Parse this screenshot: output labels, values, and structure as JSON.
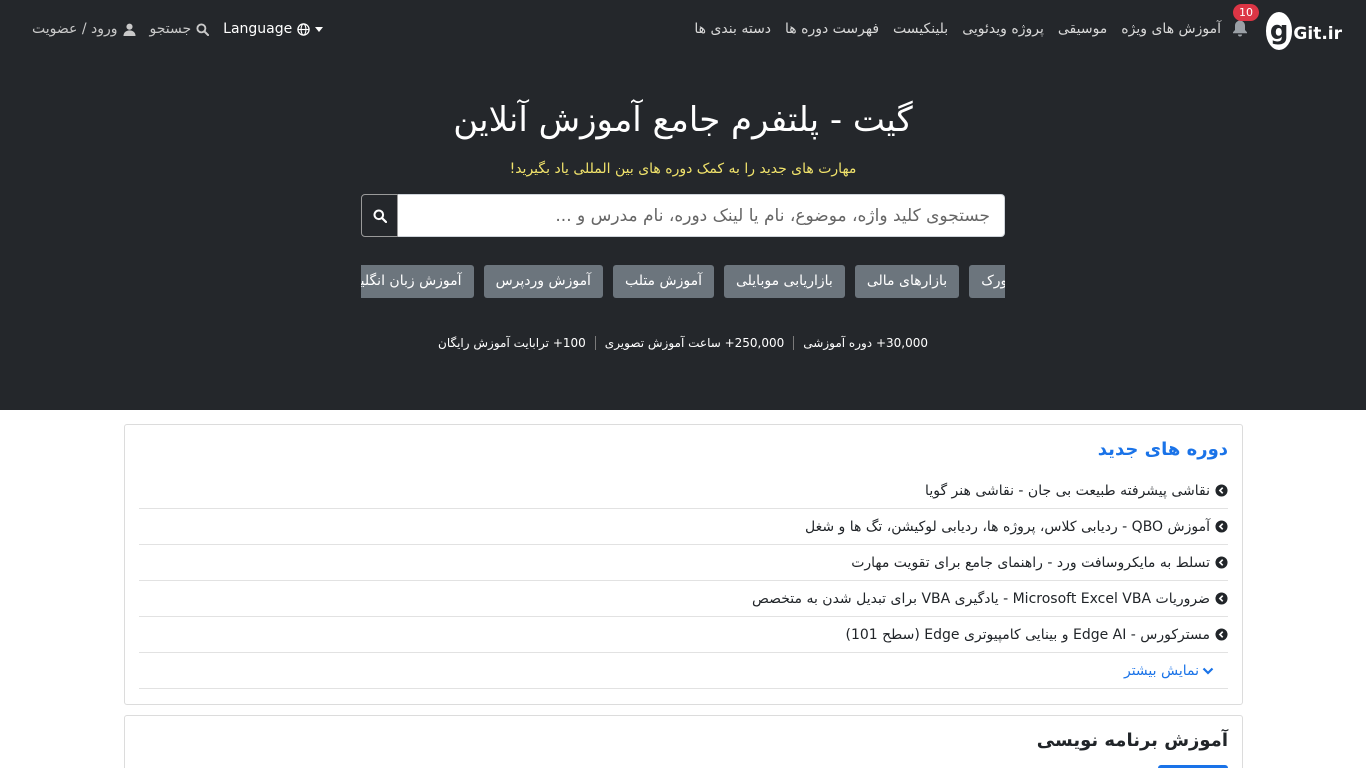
{
  "brand": {
    "logo_glyph": "g",
    "name": "Git.ir"
  },
  "notifications": {
    "count": "10"
  },
  "nav": {
    "items": [
      "دسته بندی ها",
      "فهرست دوره ها",
      "بلینکیست",
      "پروژه ویدئویی",
      "موسیقی",
      "آموزش های ویژه"
    ],
    "language_label": "Language",
    "search_label": "جستجو",
    "auth_label": "ورود / عضویت"
  },
  "hero": {
    "title": "گیت - پلتفرم جامع آموزش آنلاین",
    "subtitle": "مهارت های جدید را به کمک دوره های بین المللی یاد بگیرید!",
    "search_placeholder": "جستجوی کلید واژه، موضوع، نام یا لینک دوره، نام مدرس و ..."
  },
  "tags": [
    "آموزش زبان انگلیسی",
    "آموزش وردپرس",
    "آموزش متلب",
    "بازاریابی موبایلی",
    "بازارهای مالی",
    "آموزش سالیدورک"
  ],
  "stats": [
    "30,000+ دوره آموزشی",
    "250,000+ ساعت آموزش تصویری",
    "100+ ترابایت آموزش رایگان"
  ],
  "new_courses": {
    "title": "دوره های جدید",
    "items": [
      "نقاشی پیشرفته طبیعت بی جان - نقاشی هنر گویا",
      "آموزش QBO - ردیابی کلاس، پروژه ها، ردیابی لوکیشن، تگ ها و شغل",
      "تسلط به مایکروسافت ورد - راهنمای جامع برای تقویت مهارت",
      "ضروریات Microsoft Excel VBA - یادگیری VBA برای تبدیل شدن به متخصص",
      "مسترکورس - Edge AI و بینایی کامپیوتری Edge (سطح 101)"
    ],
    "more_label": "نمایش بیشتر"
  },
  "programming": {
    "title": "آموزش برنامه نویسی"
  },
  "colors": {
    "hero_bg": "#24272b",
    "accent": "#1a73e8",
    "badge": "#dc3545",
    "subtitle": "#f0e26b",
    "tag_bg": "#6c757d"
  }
}
